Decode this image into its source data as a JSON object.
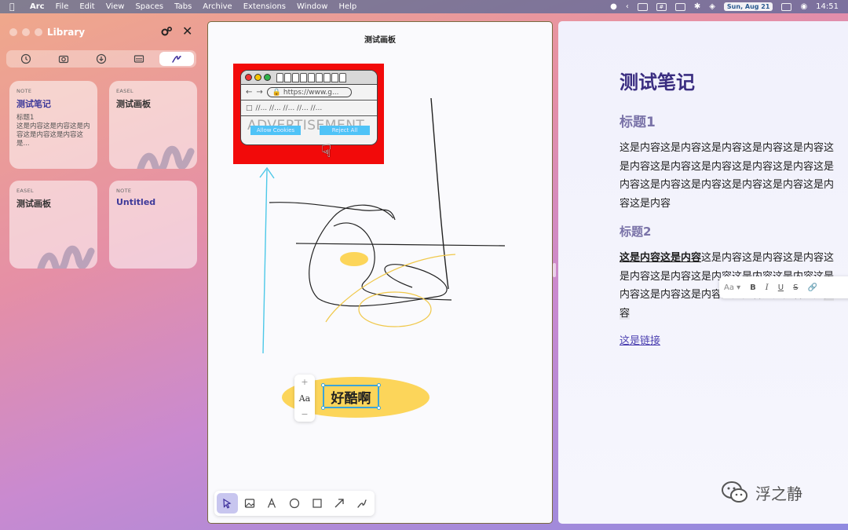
{
  "menubar": {
    "app": "Arc",
    "items": [
      "File",
      "Edit",
      "View",
      "Spaces",
      "Tabs",
      "Archive",
      "Extensions",
      "Window",
      "Help"
    ],
    "date": "Sun, Aug 21",
    "time": "14:51"
  },
  "library": {
    "title": "Library",
    "cards": [
      {
        "kind": "NOTE",
        "title": "测试笔记",
        "body": "标题1\n这是内容这是内容这是内容这是内容这是内容这是..."
      },
      {
        "kind": "EASEL",
        "title": "测试画板",
        "body": ""
      },
      {
        "kind": "EASEL",
        "title": "测试画板",
        "body": ""
      },
      {
        "kind": "NOTE",
        "title": "Untitled",
        "body": ""
      }
    ]
  },
  "canvas": {
    "title": "测试画板",
    "ad": {
      "url": "https://www.g...",
      "bookmarks": "//... //... //... //... //...",
      "headline": "ADVERTISEMENT",
      "allow": "Allow Cookies",
      "reject": "Reject All"
    },
    "text_node": "好酷啊",
    "stepper": {
      "plus": "+",
      "aa": "Aa",
      "minus": "−"
    }
  },
  "note": {
    "title": "测试笔记",
    "heading1": "标题1",
    "paragraph1": "这是内容这是内容这是内容这是内容这是内容这是内容这是内容这是内容这是内容这是内容这是内容这是内容这是内容这是内容这是内容这是内容这是内容",
    "heading2": "标题2",
    "paragraph2_bold": "这是内容这是内容",
    "paragraph2_rest": "这是内容这是内容这是内容这是内容这是内容这是内容这是内容这是内容这是内容这是内容这是内容这是内容这是内容这是",
    "paragraph2_sel": "内容",
    "link": "这是链接",
    "format_bar": {
      "aa": "Aa ▾",
      "b": "B",
      "i": "I",
      "u": "U",
      "s": "S"
    }
  },
  "watermark": "浮之静",
  "colors": {
    "accent": "#3a2d80",
    "link": "#4b3fb0",
    "selection": "#c8c6ef",
    "ad_red": "#f20a0a",
    "button_blue": "#4fc3f7",
    "highlight_yellow": "#fcd55a"
  }
}
